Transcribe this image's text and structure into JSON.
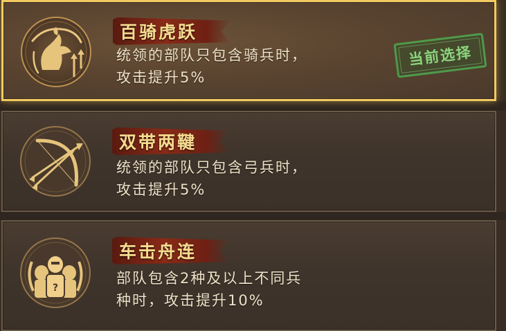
{
  "cards": [
    {
      "title": "百骑虎跃",
      "desc_line1": "统领的部队只包含骑兵时，",
      "desc_line2": "攻击提升5%",
      "icon": "horse-emblem-icon",
      "selected": true,
      "stamp": "当前选择"
    },
    {
      "title": "双带两鞬",
      "desc_line1": "统领的部队只包含弓兵时，",
      "desc_line2": "攻击提升5%",
      "icon": "bow-arrows-emblem-icon",
      "selected": false
    },
    {
      "title": "车击舟连",
      "desc_line1": "部队包含2种及以上不同兵",
      "desc_line2": "种时，攻击提升10%",
      "icon": "armored-soldiers-emblem-icon",
      "selected": false
    }
  ],
  "colors": {
    "selected_border": "#f1cb61",
    "title_text": "#f6dc8f",
    "stamp_green": "#4f9a4a",
    "banner_red": "#8a2a17"
  }
}
